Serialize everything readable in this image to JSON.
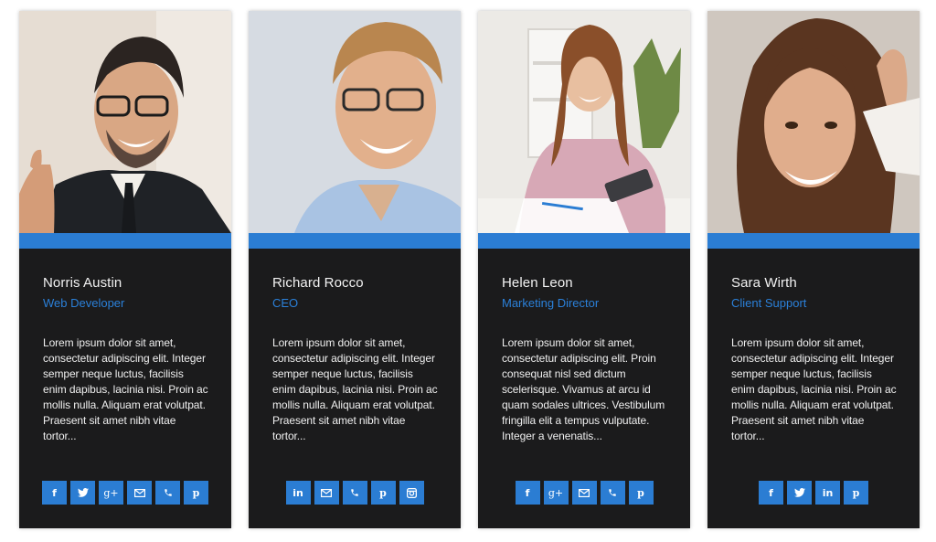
{
  "colors": {
    "card_background": "#1b1b1c",
    "accent": "#2b7dd3",
    "role_text": "#2b80d9",
    "name_text": "#f2f2f2"
  },
  "team": [
    {
      "name": "Norris Austin",
      "role": "Web Developer",
      "bio": "Lorem ipsum dolor sit amet, consectetur adipiscing elit. Integer semper neque luctus, facilisis enim dapibus, lacinia nisi. Proin ac mollis nulla. Aliquam erat volutpat. Praesent sit amet nibh vitae tortor...",
      "photo": "man-in-suit-thumbs-up",
      "social": [
        {
          "icon": "facebook-icon",
          "glyph": "f"
        },
        {
          "icon": "twitter-icon",
          "glyph": "twitter"
        },
        {
          "icon": "google-plus-icon",
          "glyph": "g+"
        },
        {
          "icon": "email-icon",
          "glyph": "mail"
        },
        {
          "icon": "phone-icon",
          "glyph": "phone"
        },
        {
          "icon": "pinterest-icon",
          "glyph": "p"
        }
      ]
    },
    {
      "name": "Richard Rocco",
      "role": "CEO",
      "bio": "Lorem ipsum dolor sit amet, consectetur adipiscing elit. Integer semper neque luctus, facilisis enim dapibus, lacinia nisi. Proin ac mollis nulla. Aliquam erat volutpat. Praesent sit amet nibh vitae tortor...",
      "photo": "smiling-man-glasses",
      "social": [
        {
          "icon": "linkedin-icon",
          "glyph": "in"
        },
        {
          "icon": "email-icon",
          "glyph": "mail"
        },
        {
          "icon": "phone-icon",
          "glyph": "phone"
        },
        {
          "icon": "pinterest-icon",
          "glyph": "p"
        },
        {
          "icon": "instagram-icon",
          "glyph": "insta"
        }
      ]
    },
    {
      "name": "Helen Leon",
      "role": "Marketing Director",
      "bio": "Lorem ipsum dolor sit amet, consectetur adipiscing elit. Proin consequat nisl sed dictum scelerisque. Vivamus at arcu id quam sodales ultrices. Vestibulum fringilla elit a tempus vulputate. Integer a venenatis...",
      "photo": "woman-at-desk-with-calculator",
      "social": [
        {
          "icon": "facebook-icon",
          "glyph": "f"
        },
        {
          "icon": "google-plus-icon",
          "glyph": "g+"
        },
        {
          "icon": "email-icon",
          "glyph": "mail"
        },
        {
          "icon": "phone-icon",
          "glyph": "phone"
        },
        {
          "icon": "pinterest-icon",
          "glyph": "p"
        }
      ]
    },
    {
      "name": "Sara Wirth",
      "role": "Client Support",
      "bio": "Lorem ipsum dolor sit amet, consectetur adipiscing elit. Integer semper neque luctus, facilisis enim dapibus, lacinia nisi. Proin ac mollis nulla. Aliquam erat volutpat. Praesent sit amet nibh vitae tortor...",
      "photo": "smiling-woman-portrait",
      "social": [
        {
          "icon": "facebook-icon",
          "glyph": "f"
        },
        {
          "icon": "twitter-icon",
          "glyph": "twitter"
        },
        {
          "icon": "linkedin-icon",
          "glyph": "in"
        },
        {
          "icon": "pinterest-icon",
          "glyph": "p"
        }
      ]
    }
  ]
}
